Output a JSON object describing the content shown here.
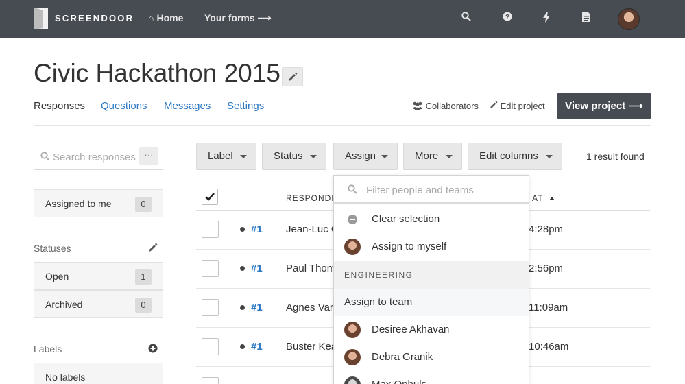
{
  "nav": {
    "brand": "SCREENDOOR",
    "home": "Home",
    "forms": "Your forms ⟶"
  },
  "project": {
    "title": "Civic Hackathon 2015"
  },
  "tabs": [
    "Responses",
    "Questions",
    "Messages",
    "Settings"
  ],
  "header_actions": {
    "collaborators": "Collaborators",
    "edit_project": "Edit project",
    "view_project": "View project ⟶"
  },
  "sidebar": {
    "search_placeholder": "Search responses",
    "more": "···",
    "assigned": {
      "label": "Assigned to me",
      "count": "0"
    },
    "statuses_heading": "Statuses",
    "statuses": [
      {
        "label": "Open",
        "count": "1"
      },
      {
        "label": "Archived",
        "count": "0"
      }
    ],
    "labels_heading": "Labels",
    "no_labels": "No labels"
  },
  "toolbar": {
    "label": "Label",
    "status": "Status",
    "assign": "Assign",
    "more": "More",
    "edit_columns": "Edit columns",
    "result_count": "1 result found"
  },
  "table": {
    "headers": {
      "respondent": "RESPONDE",
      "at": "AT"
    },
    "rows": [
      {
        "id": "#1",
        "name": "Jean-Luc Godard",
        "time": "4:28pm"
      },
      {
        "id": "#1",
        "name": "Paul Thomas",
        "time": "2:56pm"
      },
      {
        "id": "#1",
        "name": "Agnes Varda",
        "time": "11:09am"
      },
      {
        "id": "#1",
        "name": "Buster Keaton",
        "time": "10:46am"
      }
    ]
  },
  "assign_dropdown": {
    "filter_placeholder": "Filter people and teams",
    "clear": "Clear selection",
    "assign_myself": "Assign to myself",
    "group": "ENGINEERING",
    "assign_team": "Assign to team",
    "people": [
      "Desiree Akhavan",
      "Debra Granik",
      "Max Ophuls"
    ]
  },
  "colors": {
    "nav_bg": "#474b52",
    "link": "#2c78c5",
    "button_bg": "#e8e8e8"
  }
}
